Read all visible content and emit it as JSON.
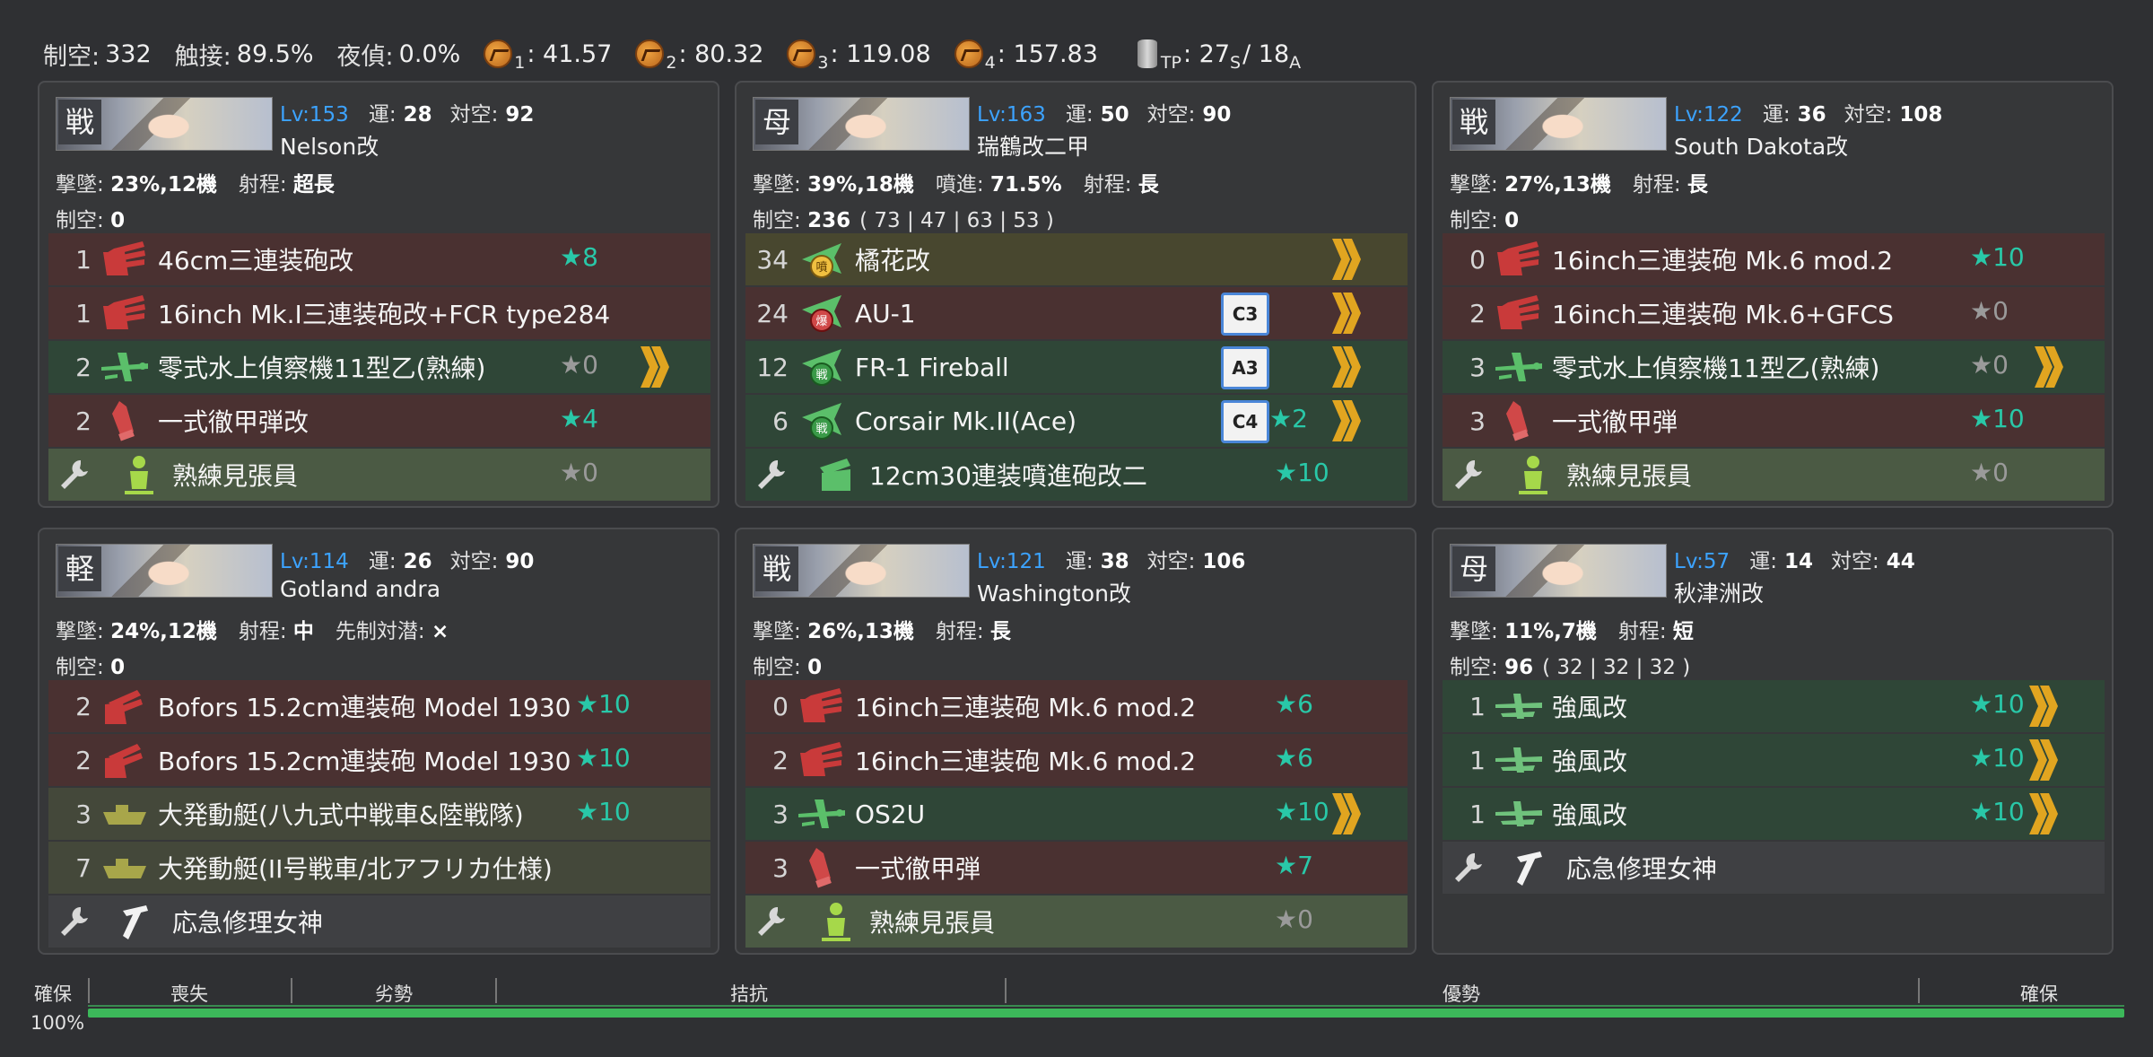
{
  "topbar": {
    "air_label": "制空:",
    "air_value": "332",
    "contact_label": "触接:",
    "contact_value": "89.5%",
    "night_label": "夜偵:",
    "night_value": "0.0%",
    "los": [
      {
        "sub": "1",
        "value": ": 41.57"
      },
      {
        "sub": "2",
        "value": ": 80.32"
      },
      {
        "sub": "3",
        "value": ": 119.08"
      },
      {
        "sub": "4",
        "value": ": 157.83"
      }
    ],
    "tp_sub": "TP",
    "tp_s": ": 27",
    "tp_s_sub": "S",
    "tp_sep": " / 18",
    "tp_a_sub": "A"
  },
  "ships": [
    {
      "type_kanji": "戦",
      "level": "Lv:153",
      "luck_label": "運:",
      "luck": "28",
      "aa_label": "対空:",
      "aa": "92",
      "name": "Nelson改",
      "meta1": [
        {
          "k": "撃墜:",
          "v": "23%,12機"
        },
        {
          "k": "射程:",
          "v": "超長"
        }
      ],
      "air_label": "制空:",
      "air": "0",
      "air_detail": "",
      "slots": [
        {
          "count": "1",
          "icon": "main-gun-icon",
          "name": "46cm三連装砲改",
          "star": "★8",
          "star_on": true,
          "color": "red"
        },
        {
          "count": "1",
          "icon": "main-gun-icon",
          "name": "16inch Mk.I三連装砲改+FCR type284",
          "star": "",
          "star_on": true,
          "color": "red"
        },
        {
          "count": "2",
          "icon": "seaplane-icon",
          "name": "零式水上偵察機11型乙(熟練)",
          "star": "★0",
          "star_on": false,
          "color": "green",
          "chevron": true
        },
        {
          "count": "2",
          "icon": "ap-shell-icon",
          "name": "一式徹甲弾改",
          "star": "★4",
          "star_on": true,
          "color": "red"
        },
        {
          "count": "",
          "icon": "lookout-icon",
          "name": "熟練見張員",
          "star": "★0",
          "star_on": false,
          "color": "exgreen",
          "ex": true
        }
      ]
    },
    {
      "type_kanji": "母",
      "level": "Lv:163",
      "luck_label": "運:",
      "luck": "50",
      "aa_label": "対空:",
      "aa": "90",
      "name": "瑞鶴改二甲",
      "meta1": [
        {
          "k": "撃墜:",
          "v": "39%,18機"
        },
        {
          "k": "噴進:",
          "v": "71.5%"
        },
        {
          "k": "射程:",
          "v": "長"
        }
      ],
      "air_label": "制空:",
      "air": "236",
      "air_detail": "( 73 | 47 | 63 | 53 )",
      "slots": [
        {
          "count": "34",
          "icon": "jet-icon",
          "name": "橘花改",
          "star": "",
          "star_on": true,
          "color": "yellow",
          "chevron": true
        },
        {
          "count": "24",
          "icon": "bomber-icon",
          "name": "AU-1",
          "star": "",
          "star_on": true,
          "color": "red",
          "chevron": true,
          "badge": "C3"
        },
        {
          "count": "12",
          "icon": "fighter-icon",
          "name": "FR-1 Fireball",
          "star": "",
          "star_on": true,
          "color": "green",
          "chevron": true,
          "badge": "A3"
        },
        {
          "count": "6",
          "icon": "fighter-icon",
          "name": "Corsair Mk.II(Ace)",
          "star": "★2",
          "star_on": true,
          "color": "green",
          "chevron": true,
          "badge": "C4"
        },
        {
          "count": "",
          "icon": "aa-gun-icon",
          "name": "12cm30連装噴進砲改二",
          "star": "★10",
          "star_on": true,
          "color": "green",
          "ex": true
        }
      ]
    },
    {
      "type_kanji": "戦",
      "level": "Lv:122",
      "luck_label": "運:",
      "luck": "36",
      "aa_label": "対空:",
      "aa": "108",
      "name": "South Dakota改",
      "meta1": [
        {
          "k": "撃墜:",
          "v": "27%,13機"
        },
        {
          "k": "射程:",
          "v": "長"
        }
      ],
      "air_label": "制空:",
      "air": "0",
      "air_detail": "",
      "slots": [
        {
          "count": "0",
          "icon": "main-gun-icon",
          "name": "16inch三連装砲 Mk.6 mod.2",
          "star": "★10",
          "star_on": true,
          "color": "red"
        },
        {
          "count": "2",
          "icon": "main-gun-icon",
          "name": "16inch三連装砲 Mk.6+GFCS",
          "star": "★0",
          "star_on": false,
          "color": "red"
        },
        {
          "count": "3",
          "icon": "seaplane-icon",
          "name": "零式水上偵察機11型乙(熟練)",
          "star": "★0",
          "star_on": false,
          "color": "green",
          "chevron": true
        },
        {
          "count": "3",
          "icon": "ap-shell-icon",
          "name": "一式徹甲弾",
          "star": "★10",
          "star_on": true,
          "color": "red"
        },
        {
          "count": "",
          "icon": "lookout-icon",
          "name": "熟練見張員",
          "star": "★0",
          "star_on": false,
          "color": "exgreen",
          "ex": true
        }
      ]
    },
    {
      "type_kanji": "軽",
      "level": "Lv:114",
      "luck_label": "運:",
      "luck": "26",
      "aa_label": "対空:",
      "aa": "90",
      "name": "Gotland andra",
      "meta1": [
        {
          "k": "撃墜:",
          "v": "24%,12機"
        },
        {
          "k": "射程:",
          "v": "中"
        },
        {
          "k": "先制対潜:",
          "v": "×"
        }
      ],
      "air_label": "制空:",
      "air": "0",
      "air_detail": "",
      "slots": [
        {
          "count": "2",
          "icon": "medium-gun-icon",
          "name": "Bofors 15.2cm連装砲 Model 1930",
          "star": "★10",
          "star_on": true,
          "color": "red"
        },
        {
          "count": "2",
          "icon": "medium-gun-icon",
          "name": "Bofors 15.2cm連装砲 Model 1930",
          "star": "★10",
          "star_on": true,
          "color": "red"
        },
        {
          "count": "3",
          "icon": "landing-craft-icon",
          "name": "大発動艇(八九式中戦車&陸戦隊)",
          "star": "★10",
          "star_on": true,
          "color": "olive"
        },
        {
          "count": "7",
          "icon": "landing-craft-icon",
          "name": "大発動艇(II号戦車/北アフリカ仕様)",
          "star": "",
          "star_on": true,
          "color": "olive"
        },
        {
          "count": "",
          "icon": "repair-goddess-icon",
          "name": "応急修理女神",
          "star": "",
          "star_on": true,
          "color": "exgray",
          "ex": true
        }
      ]
    },
    {
      "type_kanji": "戦",
      "level": "Lv:121",
      "luck_label": "運:",
      "luck": "38",
      "aa_label": "対空:",
      "aa": "106",
      "name": "Washington改",
      "meta1": [
        {
          "k": "撃墜:",
          "v": "26%,13機"
        },
        {
          "k": "射程:",
          "v": "長"
        }
      ],
      "air_label": "制空:",
      "air": "0",
      "air_detail": "",
      "slots": [
        {
          "count": "0",
          "icon": "main-gun-icon",
          "name": "16inch三連装砲 Mk.6 mod.2",
          "star": "★6",
          "star_on": true,
          "color": "red"
        },
        {
          "count": "2",
          "icon": "main-gun-icon",
          "name": "16inch三連装砲 Mk.6 mod.2",
          "star": "★6",
          "star_on": true,
          "color": "red"
        },
        {
          "count": "3",
          "icon": "seaplane-icon",
          "name": "OS2U",
          "star": "★10",
          "star_on": true,
          "color": "green",
          "chevron": true
        },
        {
          "count": "3",
          "icon": "ap-shell-icon",
          "name": "一式徹甲弾",
          "star": "★7",
          "star_on": true,
          "color": "red"
        },
        {
          "count": "",
          "icon": "lookout-icon",
          "name": "熟練見張員",
          "star": "★0",
          "star_on": false,
          "color": "exgreen",
          "ex": true
        }
      ]
    },
    {
      "type_kanji": "母",
      "level": "Lv:57",
      "luck_label": "運:",
      "luck": "14",
      "aa_label": "対空:",
      "aa": "44",
      "name": "秋津洲改",
      "meta1": [
        {
          "k": "撃墜:",
          "v": "11%,7機"
        },
        {
          "k": "射程:",
          "v": "短"
        }
      ],
      "air_label": "制空:",
      "air": "96",
      "air_detail": "( 32 | 32 | 32 )",
      "slots": [
        {
          "count": "1",
          "icon": "flying-boat-icon",
          "name": "強風改",
          "star": "★10",
          "star_on": true,
          "color": "green",
          "chevron": true
        },
        {
          "count": "1",
          "icon": "flying-boat-icon",
          "name": "強風改",
          "star": "★10",
          "star_on": true,
          "color": "green",
          "chevron": true
        },
        {
          "count": "1",
          "icon": "flying-boat-icon",
          "name": "強風改",
          "star": "★10",
          "star_on": true,
          "color": "green",
          "chevron": true
        },
        {
          "count": "",
          "icon": "repair-goddess-icon",
          "name": "応急修理女神",
          "star": "",
          "star_on": true,
          "color": "exgray",
          "ex": true
        }
      ]
    }
  ],
  "gauge": {
    "left_label": "確保",
    "percent": "100%",
    "segments": [
      "喪失",
      "劣勢",
      "拮抗",
      "優勢",
      "確保"
    ],
    "fill_fraction": 1.0
  },
  "colors": {
    "level": "#3ca3ff",
    "star_on": "#29c8a8",
    "star_off": "#9a9a9a",
    "gauge": "#3cb85a"
  }
}
